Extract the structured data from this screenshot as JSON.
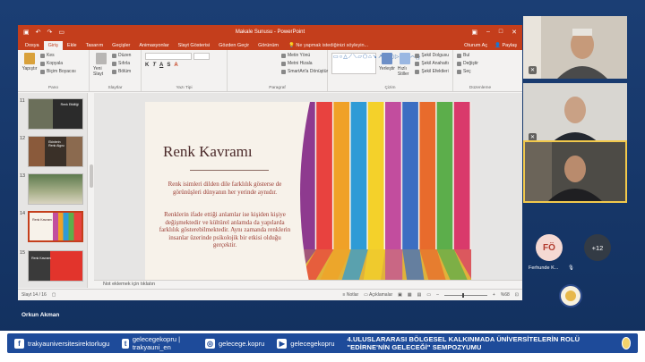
{
  "ppt": {
    "window_title": "Makale Sunusu - PowerPoint",
    "tabs": [
      "Dosya",
      "Giriş",
      "Ekle",
      "Tasarım",
      "Geçişler",
      "Animasyonlar",
      "Slayt Gösterisi",
      "Gözden Geçir",
      "Görünüm"
    ],
    "active_tab": "Giriş",
    "tell_me": "Ne yapmak istediğinizi söyleyin...",
    "account": "Oturum Aç",
    "share": "Paylaş",
    "ribbon": {
      "paste": "Yapıştır",
      "cut": "Kes",
      "copy": "Kopyala",
      "format_painter": "Biçim Boyacısı",
      "new_slide": "Yeni Slayt",
      "layout": "Düzen",
      "reset": "Sıfırla",
      "section": "Bölüm",
      "text_direction": "Metin Yönü",
      "align_text": "Metni Hizala",
      "smartart": "SmartArt'a Dönüştür",
      "arrange": "Yerleştir",
      "quick_styles": "Hızlı Stiller",
      "shape_fill": "Şekil Dolgusu",
      "shape_outline": "Şekil Anahattı",
      "shape_effects": "Şekil Efektleri",
      "find": "Bul",
      "replace": "Değiştir",
      "select": "Seç",
      "group_clipboard": "Pano",
      "group_slides": "Slaytlar",
      "group_font": "Yazı Tipi",
      "group_paragraph": "Paragraf",
      "group_drawing": "Çizim",
      "group_editing": "Düzenleme"
    },
    "thumbnails": [
      {
        "num": "11",
        "caption": "Renk Etkilliği"
      },
      {
        "num": "12",
        "caption": "Ekinlerin Renk Algısı"
      },
      {
        "num": "13",
        "caption": ""
      },
      {
        "num": "14",
        "caption": "Renk Kavramı"
      },
      {
        "num": "15",
        "caption": "Renk Kavramı"
      }
    ],
    "slide": {
      "title": "Renk Kavramı",
      "para1": "Renk isimleri dilden dile farklılık gösterse de görünüşleri dünyanın her yerinde aynıdır.",
      "para2": "Renklerin ifade ettiği anlamlar ise kişiden kişiye değişmektedir ve kültürel anlamda da yapılarda farklılık gösterebilmektedir. Aynı zamanda renklerin insanlar üzerinde psikolojik bir etkisi olduğu gerçektir."
    },
    "notes_placeholder": "Not eklemek için tıklatın",
    "status": {
      "slide_count": "Slayt 14 / 16",
      "notes_btn": "Notlar",
      "comments_btn": "Açıklamalar",
      "zoom": "%68"
    },
    "plank_colors": [
      "#8e3a8f",
      "#e8423f",
      "#f0a127",
      "#2e9bd6",
      "#f4d12a",
      "#c24d9e",
      "#3c6ec2",
      "#e86b2c",
      "#5cae4b",
      "#d93a6b"
    ]
  },
  "presenter": {
    "name": "Orkun Akman"
  },
  "participants": {
    "initials": "FÖ",
    "extra": "+12",
    "name": "Ferhunde K..."
  },
  "footer": {
    "facebook": "trakyauniversitesirektorlugu",
    "twitter": "gelecegekopru | trakyauni_en",
    "instagram": "gelecege.kopru",
    "youtube": "gelecegekopru",
    "symposium": "4.ULUSLARARASI BÖLGESEL KALKINMADA ÜNİVERSİTELERİN ROLÜ \"EDİRNE'NİN GELECEĞİ\" SEMPOZYUMU"
  }
}
